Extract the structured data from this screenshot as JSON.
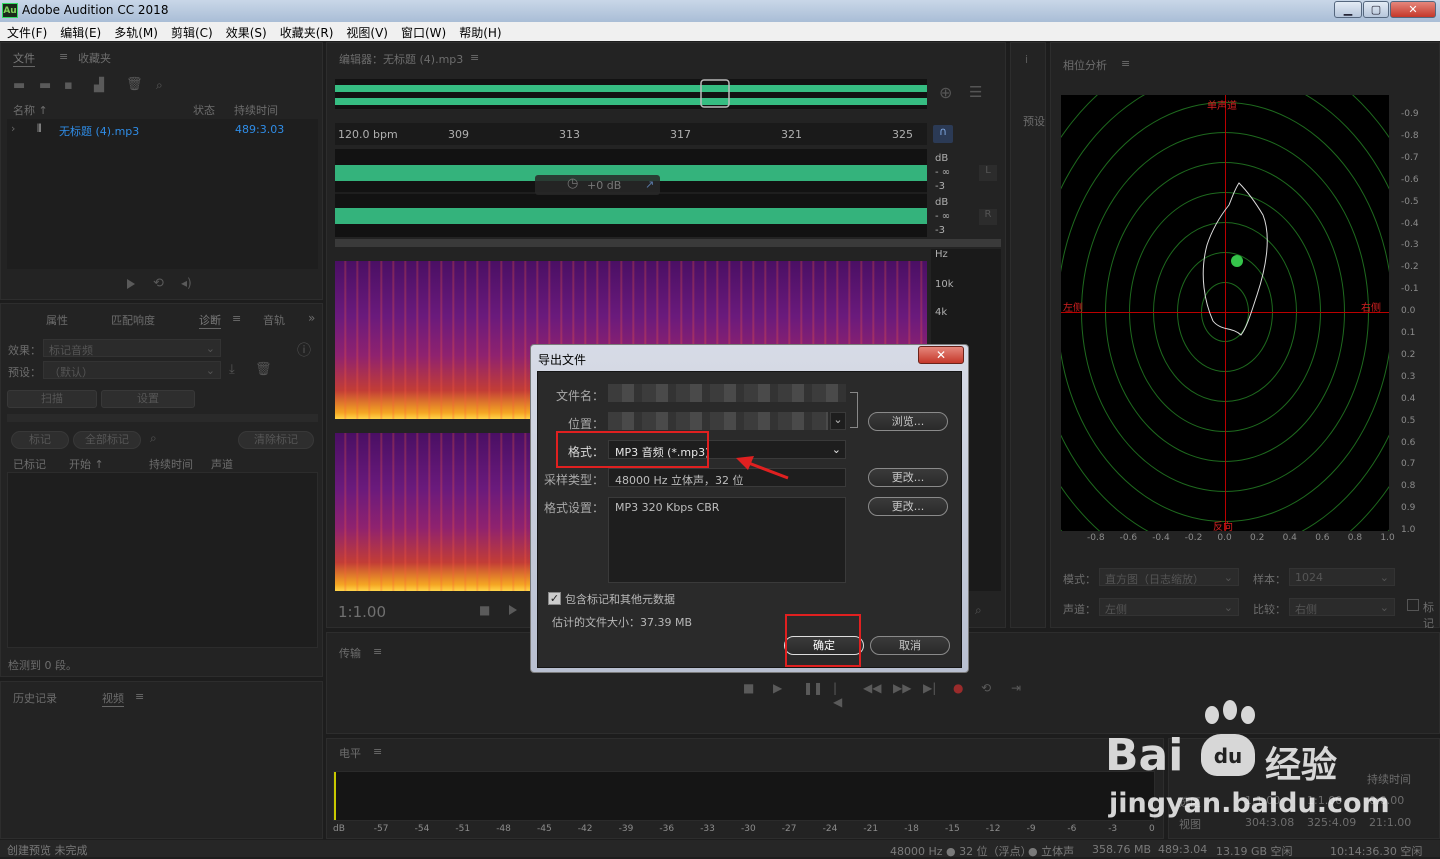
{
  "window": {
    "title": "Adobe Audition CC 2018",
    "icon_text": "Au",
    "min": "▁",
    "max": "▢",
    "close": "✕"
  },
  "menu": [
    "文件(F)",
    "编辑(E)",
    "多轨(M)",
    "剪辑(C)",
    "效果(S)",
    "收藏夹(R)",
    "视图(V)",
    "窗口(W)",
    "帮助(H)"
  ],
  "files_panel": {
    "tabs": [
      "文件",
      "收藏夹"
    ],
    "columns": {
      "name": "名称 ↑",
      "status": "状态",
      "duration": "持续时间"
    },
    "file": {
      "name": "无标题 (4).mp3",
      "duration": "489:3.03"
    }
  },
  "diag_panel": {
    "tabs": [
      "属性",
      "匹配响度",
      "诊断",
      "音轨"
    ],
    "effect_label": "效果：",
    "effect_value": "标记音频",
    "preset_label": "预设：",
    "preset_value": "（默认）",
    "scan": "扫描",
    "settings": "设置",
    "mark": "标记",
    "mark_all": "全部标记",
    "clear": "清除标记",
    "cols": [
      "已标记",
      "开始 ↑",
      "持续时间",
      "声道"
    ],
    "detected": "检测到 0 段。"
  },
  "history_panel": {
    "tabs": [
      "历史记录",
      "视频"
    ]
  },
  "editor": {
    "title": "编辑器：无标题 (4).mp3",
    "bpm": "120.0 bpm",
    "ruler": [
      "309",
      "313",
      "317",
      "321",
      "325"
    ],
    "db_labels": [
      "dB",
      "- ∞",
      "-3",
      "dB",
      "- ∞",
      "-3"
    ],
    "hz_labels": [
      "Hz",
      "10k",
      "4k"
    ],
    "gain": "+0 dB",
    "timecode": "1:1.00",
    "channel_l": "L",
    "channel_r": "R"
  },
  "transport_panel": {
    "title": "传输"
  },
  "level_panel": {
    "title": "电平",
    "scale": [
      "dB",
      "-57",
      "-54",
      "-51",
      "-48",
      "-45",
      "-42",
      "-39",
      "-36",
      "-33",
      "-30",
      "-27",
      "-24",
      "-21",
      "-18",
      "-15",
      "-12",
      "-9",
      "-6",
      "-3",
      "0"
    ]
  },
  "selection_panel": {
    "duration_header": "持续时间",
    "rows": [
      {
        "label": "选区",
        "start": "1:1.00",
        "end": "1:1.00",
        "dur": "0:0.00"
      },
      {
        "label": "视图",
        "start": "304:3.08",
        "end": "325:4.09",
        "dur": "21:1.00"
      }
    ]
  },
  "phase_panel": {
    "title": "相位分析",
    "top_label": "单声道",
    "bottom_label": "反向",
    "left_label": "左侧",
    "right_label": "右侧",
    "y_ticks": [
      "-0.9",
      "-0.8",
      "-0.7",
      "-0.6",
      "-0.5",
      "-0.4",
      "-0.3",
      "-0.2",
      "-0.1",
      "0.0",
      "0.1",
      "0.2",
      "0.3",
      "0.4",
      "0.5",
      "0.6",
      "0.7",
      "0.8",
      "0.9",
      "1.0"
    ],
    "x_ticks": [
      "-0.8",
      "-0.6",
      "-0.4",
      "-0.2",
      "0.0",
      "0.2",
      "0.4",
      "0.6",
      "0.8",
      "1.0"
    ],
    "mode_label": "模式：",
    "mode_value": "直方图（日志缩放）",
    "sample_label": "样本：",
    "sample_value": "1024",
    "channel_label": "声道：",
    "channel_value": "左侧",
    "compare_label": "比较：",
    "compare_value": "右侧",
    "mark_label": "标记"
  },
  "presets_tab": "预设",
  "dialog": {
    "title": "导出文件",
    "close": "✕",
    "filename_label": "文件名：",
    "location_label": "位置：",
    "browse": "浏览...",
    "format_label": "格式：",
    "format_value": "MP3 音频 (*.mp3)",
    "sample_label": "采样类型：",
    "sample_value": "48000 Hz 立体声，32 位",
    "change1": "更改...",
    "format_settings_label": "格式设置：",
    "format_settings_value": "MP3 320 Kbps CBR",
    "change2": "更改...",
    "include_markers": "包含标记和其他元数据",
    "estimated_size": "估计的文件大小：37.39 MB",
    "ok": "确定",
    "cancel": "取消"
  },
  "status": {
    "left": "创建预览 未完成",
    "items": [
      "48000 Hz ● 32 位（浮点）",
      "● 立体声",
      "358.76 MB",
      "489:3.04",
      "13.19 GB 空闲",
      "10:14:36.30 空闲"
    ]
  },
  "watermark": {
    "brand": "Bai",
    "paw": "du",
    "suffix": "经验",
    "url": "jingyan.baidu.com"
  },
  "colors": {
    "waveform": "#3ddc97",
    "accent_blue": "#2f8ce6",
    "highlight_red": "#e02020",
    "phase_green": "#1e6a1e"
  }
}
